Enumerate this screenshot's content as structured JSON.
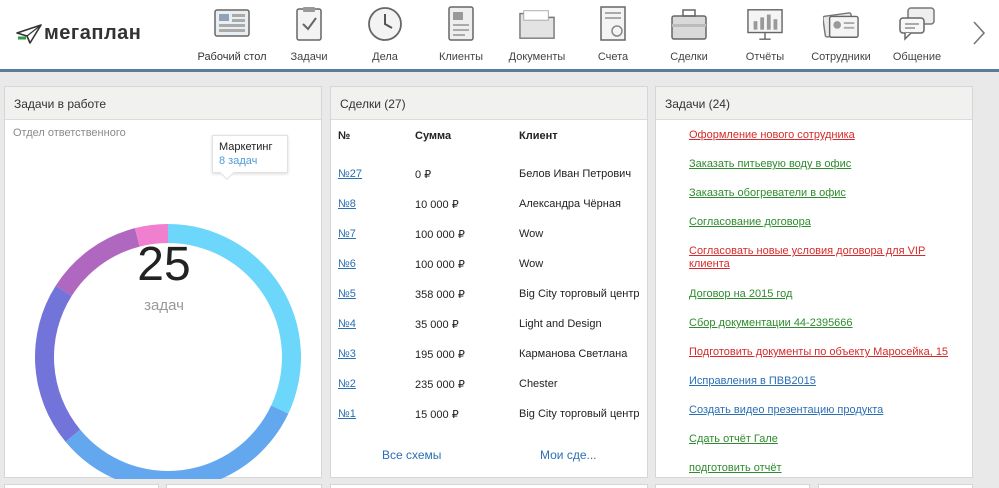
{
  "app": {
    "logo_text": "мегаплан",
    "nav": [
      {
        "label": "Рабочий стол",
        "icon": "desktop-icon"
      },
      {
        "label": "Задачи",
        "icon": "clipboard-icon"
      },
      {
        "label": "Дела",
        "icon": "clock-icon"
      },
      {
        "label": "Клиенты",
        "icon": "contacts-book-icon"
      },
      {
        "label": "Документы",
        "icon": "folder-icon"
      },
      {
        "label": "Счета",
        "icon": "invoice-icon"
      },
      {
        "label": "Сделки",
        "icon": "briefcase-icon"
      },
      {
        "label": "Отчёты",
        "icon": "report-board-icon"
      },
      {
        "label": "Сотрудники",
        "icon": "employee-cards-icon"
      },
      {
        "label": "Общение",
        "icon": "chat-icon"
      }
    ],
    "next_icon": "chevron-right-icon"
  },
  "tasks_in_work": {
    "title": "Задачи в работе",
    "subtitle": "Отдел ответственного",
    "total": "25",
    "total_label": "задач",
    "tooltip": {
      "name": "Маркетинг",
      "count": "8 задач"
    },
    "chart_data": {
      "type": "pie",
      "slices": [
        {
          "name": "Маркетинг",
          "value": 8,
          "color": "#6dd6fb"
        },
        {
          "value": 8,
          "color": "#63a7ee"
        },
        {
          "value": 5,
          "color": "#7274d9"
        },
        {
          "value": 3,
          "color": "#b067c0"
        },
        {
          "value": 1,
          "color": "#f07fd0"
        }
      ],
      "total": 25
    }
  },
  "deals": {
    "title": "Сделки (27)",
    "headers": {
      "num": "№",
      "sum": "Сумма",
      "client": "Клиент"
    },
    "rows": [
      {
        "num": "№27",
        "sum": "0 ₽",
        "client": "Белов Иван Петрович"
      },
      {
        "num": "№8",
        "sum": "10 000 ₽",
        "client": "Александра Чёрная"
      },
      {
        "num": "№7",
        "sum": "100 000 ₽",
        "client": "Wow"
      },
      {
        "num": "№6",
        "sum": "100 000 ₽",
        "client": "Wow"
      },
      {
        "num": "№5",
        "sum": "358 000 ₽",
        "client": "Big City торговый центр"
      },
      {
        "num": "№4",
        "sum": "35 000 ₽",
        "client": "Light and Design"
      },
      {
        "num": "№3",
        "sum": "195 000 ₽",
        "client": "Карманова Светлана"
      },
      {
        "num": "№2",
        "sum": "235 000 ₽",
        "client": "Chester"
      },
      {
        "num": "№1",
        "sum": "15 000 ₽",
        "client": "Big City торговый центр"
      }
    ],
    "link_all": "Все схемы",
    "link_mine": "Мои сде..."
  },
  "tasks": {
    "title": "Задачи (24)",
    "items": [
      {
        "text": "Оформление нового сотрудника",
        "status": "red"
      },
      {
        "text": "Заказать питьевую воду в офис",
        "status": "green"
      },
      {
        "text": "Заказать обогреватели в офис",
        "status": "green"
      },
      {
        "text": "Согласование договора",
        "status": "green"
      },
      {
        "text": "Согласовать новые условия договора для VIP клиента",
        "status": "red"
      },
      {
        "text": "Договор на 2015 год",
        "status": "green"
      },
      {
        "text": "Сбор документации 44-2395666",
        "status": "green"
      },
      {
        "text": "Подготовить документы по объекту Маросейка, 15",
        "status": "red"
      },
      {
        "text": "Исправления в ПВВ2015",
        "status": "blue"
      },
      {
        "text": "Создать видео презентацию продукта",
        "status": "blue"
      },
      {
        "text": "Сдать отчёт Гале",
        "status": "green"
      },
      {
        "text": "подготовить отчёт",
        "status": "green"
      }
    ]
  }
}
